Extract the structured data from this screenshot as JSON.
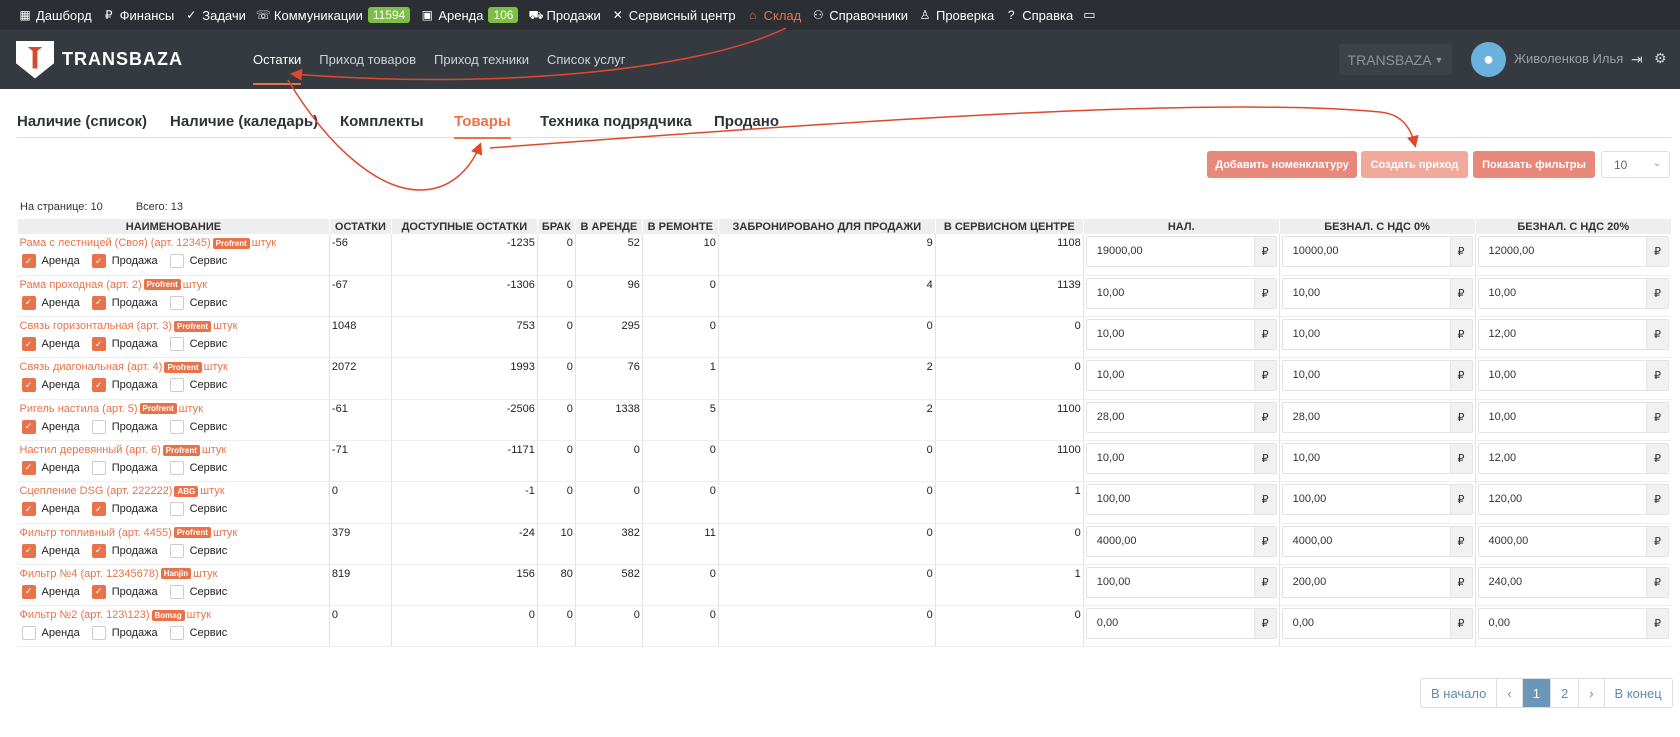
{
  "topnav": {
    "items": [
      {
        "label": "Дашборд",
        "icon": "dashboard-icon"
      },
      {
        "label": "Финансы",
        "icon": "ruble-icon"
      },
      {
        "label": "Задачи",
        "icon": "check-circle-icon"
      },
      {
        "label": "Коммуникации",
        "icon": "phone-icon",
        "badge": "11594"
      },
      {
        "label": "Аренда",
        "icon": "briefcase-icon",
        "badge": "106"
      },
      {
        "label": "Продажи",
        "icon": "cart-icon"
      },
      {
        "label": "Сервисный центр",
        "icon": "tools-icon"
      },
      {
        "label": "Склад",
        "icon": "warehouse-icon",
        "active": true
      },
      {
        "label": "Справочники",
        "icon": "users-icon"
      },
      {
        "label": "Проверка",
        "icon": "user-check-icon"
      },
      {
        "label": "Справка",
        "icon": "help-icon"
      }
    ]
  },
  "header": {
    "brand": "TRANSBAZA",
    "nav": [
      "Остатки",
      "Приход товаров",
      "Приход техники",
      "Список услуг"
    ],
    "company": "TRANSBAZA",
    "user": "Живоленков Илья"
  },
  "subtabs": [
    "Наличие (список)",
    "Наличие (каледарь)",
    "Комплекты",
    "Товары",
    "Техника подрядчика",
    "Продано"
  ],
  "actions": {
    "add": "Добавить номенклатуру",
    "create": "Создать приход",
    "filters": "Показать фильтры",
    "page_size": "10"
  },
  "stats": {
    "per_page": "На странице: 10",
    "total": "Всего: 13"
  },
  "columns": [
    "НАИМЕНОВАНИЕ",
    "ОСТАТКИ",
    "ДОСТУПНЫЕ ОСТАТКИ",
    "БРАК",
    "В АРЕНДЕ",
    "В РЕМОНТЕ",
    "ЗАБРОНИРОВАНО ДЛЯ ПРОДАЖИ",
    "В СЕРВИСНОМ ЦЕНТРЕ",
    "НАЛ.",
    "БЕЗНАЛ. С НДС 0%",
    "БЕЗНАЛ. С НДС 20%"
  ],
  "check_labels": [
    "Аренда",
    "Продажа",
    "Сервис"
  ],
  "unit": "штук",
  "currency": "₽",
  "rows": [
    {
      "name": "Рама с лестницей (Своя) (арт. 12345)",
      "brand": "Profrent",
      "checks": [
        true,
        true,
        false
      ],
      "ost": "-56",
      "avail": "-1235",
      "brak": "0",
      "rent": "52",
      "repair": "10",
      "reserved": "9",
      "service": "1108",
      "p1": "19000,00",
      "p2": "10000,00",
      "p3": "12000,00"
    },
    {
      "name": "Рама проходная (арт. 2)",
      "brand": "Profrent",
      "checks": [
        true,
        true,
        false
      ],
      "ost": "-67",
      "avail": "-1306",
      "brak": "0",
      "rent": "96",
      "repair": "0",
      "reserved": "4",
      "service": "1139",
      "p1": "10,00",
      "p2": "10,00",
      "p3": "10,00"
    },
    {
      "name": "Связь горизонтальная (арт. 3)",
      "brand": "Profrent",
      "checks": [
        true,
        true,
        false
      ],
      "ost": "1048",
      "avail": "753",
      "brak": "0",
      "rent": "295",
      "repair": "0",
      "reserved": "0",
      "service": "0",
      "p1": "10,00",
      "p2": "10,00",
      "p3": "12,00"
    },
    {
      "name": "Связь диагональная (арт. 4)",
      "brand": "Profrent",
      "checks": [
        true,
        true,
        false
      ],
      "ost": "2072",
      "avail": "1993",
      "brak": "0",
      "rent": "76",
      "repair": "1",
      "reserved": "2",
      "service": "0",
      "p1": "10,00",
      "p2": "10,00",
      "p3": "10,00"
    },
    {
      "name": "Ригель настила (арт. 5)",
      "brand": "Profrent",
      "checks": [
        true,
        false,
        false
      ],
      "ost": "-61",
      "avail": "-2506",
      "brak": "0",
      "rent": "1338",
      "repair": "5",
      "reserved": "2",
      "service": "1100",
      "p1": "28,00",
      "p2": "28,00",
      "p3": "10,00"
    },
    {
      "name": "Настил деревянный (арт. 6)",
      "brand": "Profrent",
      "checks": [
        true,
        false,
        false
      ],
      "ost": "-71",
      "avail": "-1171",
      "brak": "0",
      "rent": "0",
      "repair": "0",
      "reserved": "0",
      "service": "1100",
      "p1": "10,00",
      "p2": "10,00",
      "p3": "12,00"
    },
    {
      "name": "Сцепление DSG (арт. 222222)",
      "brand": "ABG",
      "checks": [
        true,
        true,
        false
      ],
      "ost": "0",
      "avail": "-1",
      "brak": "0",
      "rent": "0",
      "repair": "0",
      "reserved": "0",
      "service": "1",
      "p1": "100,00",
      "p2": "100,00",
      "p3": "120,00"
    },
    {
      "name": "Фильтр топливный (арт. 4455)",
      "brand": "Profrent",
      "checks": [
        true,
        true,
        false
      ],
      "ost": "379",
      "avail": "-24",
      "brak": "10",
      "rent": "382",
      "repair": "11",
      "reserved": "0",
      "service": "0",
      "p1": "4000,00",
      "p2": "4000,00",
      "p3": "4000,00"
    },
    {
      "name": "Фильтр №4 (арт. 12345678)",
      "brand": "Hanjin",
      "checks": [
        true,
        true,
        false
      ],
      "ost": "819",
      "avail": "156",
      "brak": "80",
      "rent": "582",
      "repair": "0",
      "reserved": "0",
      "service": "1",
      "p1": "100,00",
      "p2": "200,00",
      "p3": "240,00"
    },
    {
      "name": "Фильтр №2 (арт. 123\\123)",
      "brand": "Bomag",
      "checks": [
        false,
        false,
        false
      ],
      "ost": "0",
      "avail": "0",
      "brak": "0",
      "rent": "0",
      "repair": "0",
      "reserved": "0",
      "service": "0",
      "p1": "0,00",
      "p2": "0,00",
      "p3": "0,00"
    }
  ],
  "pager": {
    "first": "В начало",
    "prev": "‹",
    "pages": [
      "1",
      "2"
    ],
    "next": "›",
    "last": "В конец"
  },
  "colors": {
    "accent": "#e8734a",
    "topbar": "#2b2f33",
    "header": "#353a40",
    "badge": "#7cbf44"
  }
}
